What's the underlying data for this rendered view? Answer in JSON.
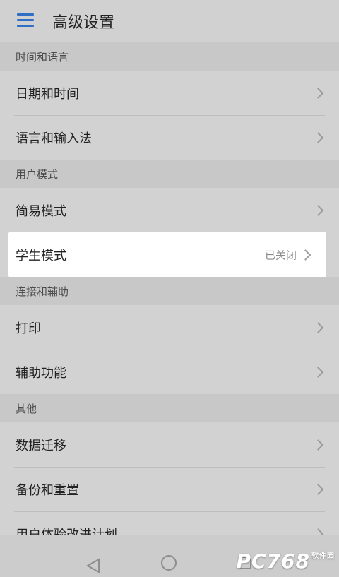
{
  "header": {
    "title": "高级设置",
    "menu_icon": "hamburger-menu-icon"
  },
  "sections": [
    {
      "title": "时间和语言",
      "items": [
        {
          "label": "日期和时间"
        },
        {
          "label": "语言和输入法"
        }
      ]
    },
    {
      "title": "用户模式",
      "items": [
        {
          "label": "简易模式"
        },
        {
          "label": "学生模式",
          "value": "已关闭"
        }
      ]
    },
    {
      "title": "连接和辅助",
      "items": [
        {
          "label": "打印"
        },
        {
          "label": "辅助功能"
        }
      ]
    },
    {
      "title": "其他",
      "items": [
        {
          "label": "数据迁移"
        },
        {
          "label": "备份和重置"
        },
        {
          "label": "用户体验改进计划"
        }
      ]
    }
  ],
  "navbar": {
    "back_icon": "back-triangle-icon",
    "home_icon": "home-circle-icon",
    "recent_icon": "recent-square-icon"
  },
  "watermark": {
    "text": "PC768",
    "sub": "软件园"
  }
}
